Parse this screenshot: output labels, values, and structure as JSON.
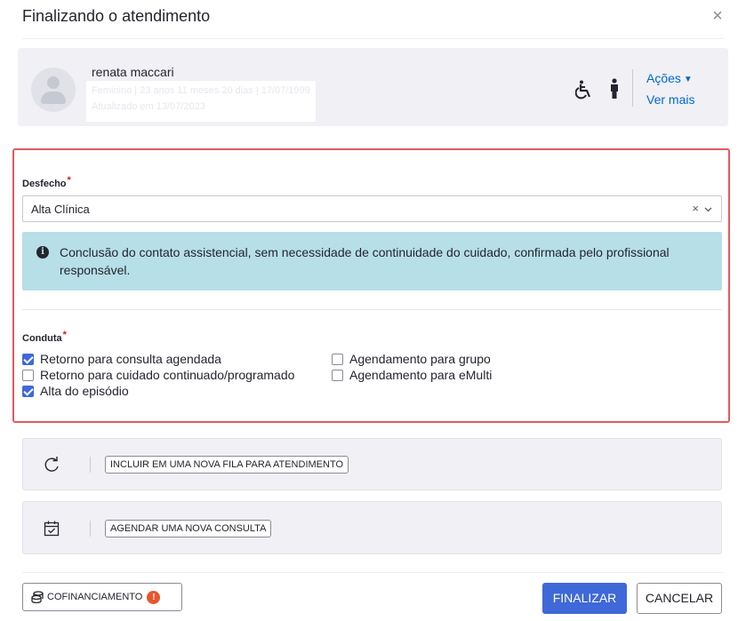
{
  "modal": {
    "title": "Finalizando o atendimento",
    "close_icon": "close-icon"
  },
  "patient": {
    "name": "renata maccari",
    "info_line_1": "Feminino | 23 anos 11 meses 20 dias | 17/07/1999",
    "info_line_2": "Atualizado em 13/07/2023",
    "icons": [
      "wheelchair-icon",
      "person-icon"
    ],
    "acoes_label": "Ações",
    "ver_mais_label": "Ver mais"
  },
  "desfecho": {
    "label": "Desfecho",
    "required_mark": "*",
    "selected": "Alta Clínica",
    "clear_glyph": "×",
    "info_text": "Conclusão do contato assistencial, sem necessidade de continuidade do cuidado, confirmada pelo profissional responsável."
  },
  "conduta": {
    "label": "Conduta",
    "required_mark": "*",
    "options": [
      {
        "label": "Retorno para consulta agendada",
        "checked": true
      },
      {
        "label": "Retorno para cuidado continuado/programado",
        "checked": false
      },
      {
        "label": "Alta do episódio",
        "checked": true
      },
      {
        "label": "Agendamento para grupo",
        "checked": false
      },
      {
        "label": "Agendamento para eMulti",
        "checked": false
      }
    ]
  },
  "actions": {
    "fila_label": "INCLUIR EM UMA NOVA FILA PARA ATENDIMENTO",
    "consulta_label": "AGENDAR UMA NOVA CONSULTA"
  },
  "footer": {
    "cofinanciamento_label": "COFINANCIAMENTO",
    "cofinanciamento_badge": "!",
    "finalizar_label": "FINALIZAR",
    "cancelar_label": "CANCELAR"
  },
  "colors": {
    "primary": "#3f68d8",
    "link": "#0069d0",
    "highlight_frame": "#e35a5d",
    "info_bg": "#b7dfe8",
    "alert_badge": "#e8562b"
  }
}
